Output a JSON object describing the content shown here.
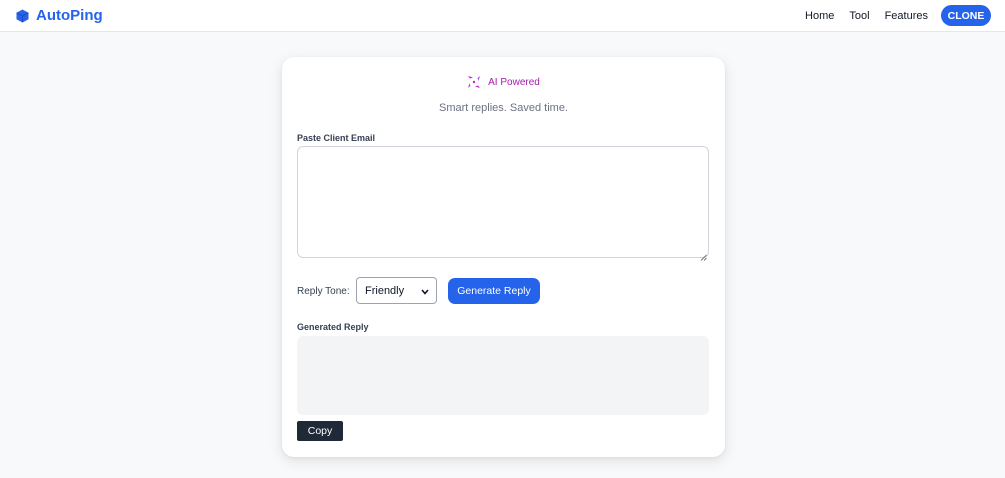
{
  "navbar": {
    "brand": "AutoPing",
    "brand_icon": "cube-icon",
    "links": [
      "Home",
      "Tool",
      "Features"
    ],
    "cta_label": "CLONE",
    "accent_color": "#2563eb"
  },
  "card": {
    "badge_icon": "sparkles-icon",
    "badge_text": "AI Powered",
    "badge_color": "#a21caf",
    "tagline": "Smart replies. Saved time.",
    "email_label": "Paste Client Email",
    "email_value": "",
    "email_placeholder": "",
    "tone_label": "Reply Tone:",
    "tone_selected": "Friendly",
    "generate_label": "Generate Reply",
    "reply_label": "Generated Reply",
    "reply_value": "",
    "copy_label": "Copy"
  }
}
